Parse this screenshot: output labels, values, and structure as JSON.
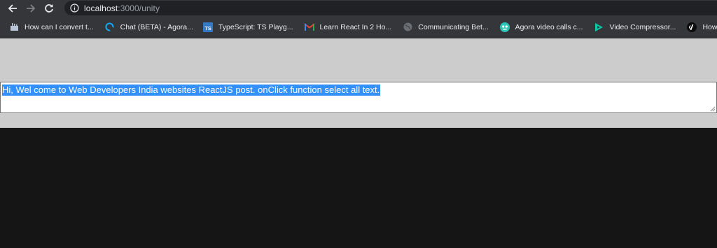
{
  "browser": {
    "url_host": "localhost",
    "url_rest": ":3000/unity",
    "colors": {
      "toolbar": "#35363a",
      "omnibox": "#202124",
      "selection": "#3390ff",
      "page_bg": "#cccccc"
    }
  },
  "bookmarks": [
    {
      "label": "How can I convert t...",
      "icon": "stack-icon"
    },
    {
      "label": "Chat (BETA) - Agora...",
      "icon": "agora-chat-icon"
    },
    {
      "label": "TypeScript: TS Playg...",
      "icon": "typescript-icon"
    },
    {
      "label": "Learn React In 2 Ho...",
      "icon": "gmail-icon"
    },
    {
      "label": "Communicating Bet...",
      "icon": "globe-icon"
    },
    {
      "label": "Agora video calls c...",
      "icon": "agora-video-icon"
    },
    {
      "label": "Video Compressor...",
      "icon": "play-icon"
    },
    {
      "label": "How to Run Foreac",
      "icon": "code-icon"
    }
  ],
  "textarea": {
    "value": "Hi, Wel come to Web Developers India websites ReactJS post. onClick function select all text."
  }
}
